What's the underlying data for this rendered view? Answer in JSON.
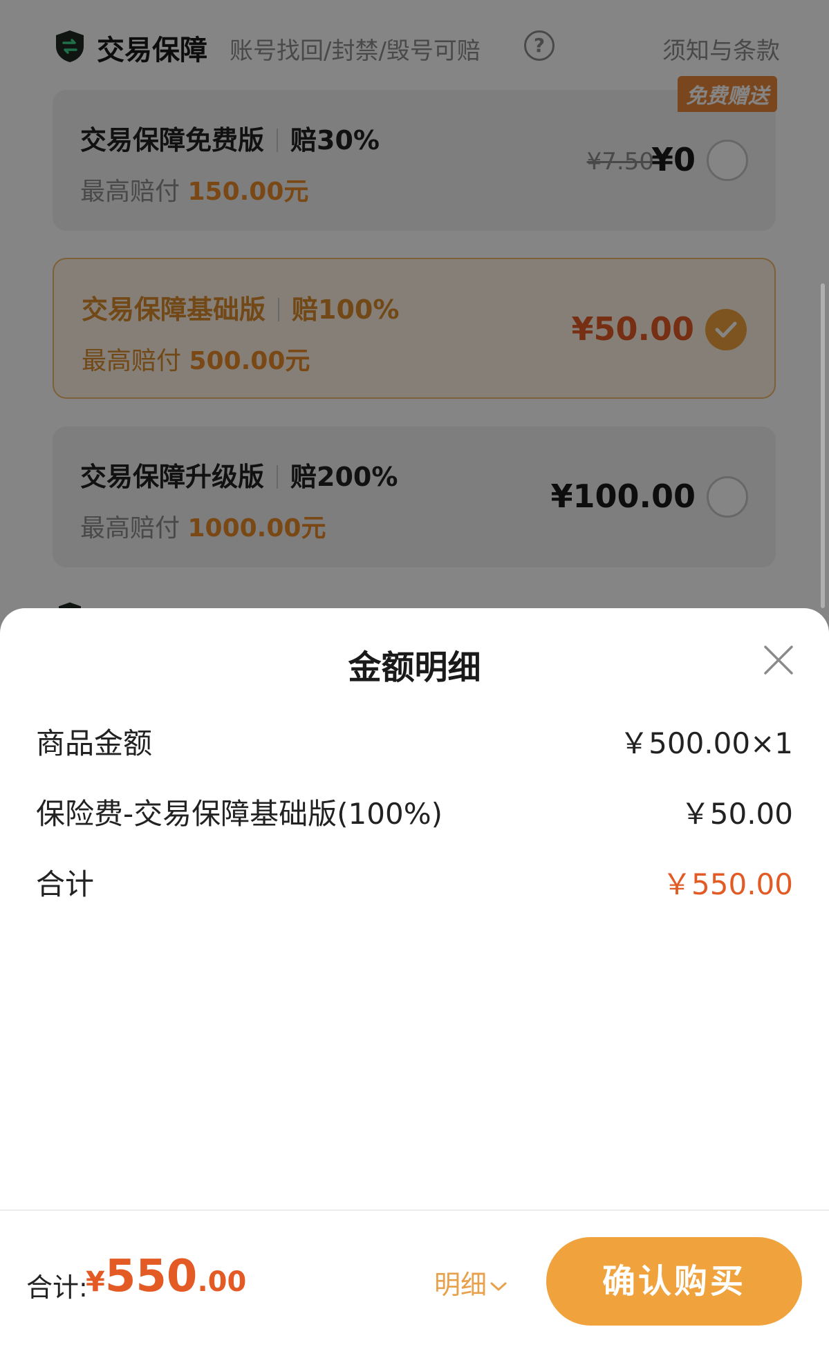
{
  "guarantee": {
    "title": "交易保障",
    "subtitle": "账号找回/封禁/毁号可赔",
    "help_icon": "?",
    "terms_link": "须知与条款",
    "plans": [
      {
        "name": "交易保障免费版",
        "payout": "赔30%",
        "max_label": "最高赔付",
        "max_amount": "150.00元",
        "old_price": "¥7.50",
        "price": "¥0",
        "tag": "免费赠送",
        "selected": false
      },
      {
        "name": "交易保障基础版",
        "payout": "赔100%",
        "max_label": "最高赔付",
        "max_amount": "500.00元",
        "price": "¥50.00",
        "selected": true
      },
      {
        "name": "交易保障升级版",
        "payout": "赔200%",
        "max_label": "最高赔付",
        "max_amount": "1000.00元",
        "price": "¥100.00",
        "selected": false
      }
    ]
  },
  "sheet": {
    "title": "金额明细",
    "rows": [
      {
        "label": "商品金额",
        "value": "￥500.00×1"
      },
      {
        "label": "保险费-交易保障基础版(100%)",
        "value": "￥50.00"
      },
      {
        "label": "合计",
        "value": "￥550.00"
      }
    ]
  },
  "footer": {
    "total_label": "合计:",
    "total_symbol": "¥",
    "total_integer": "550",
    "total_decimal": ".00",
    "detail_label": "明细",
    "confirm_label": "确认购买"
  },
  "colors": {
    "accent_orange": "#f0a23c",
    "price_red": "#e35a25",
    "tag_orange": "#e8863a"
  }
}
